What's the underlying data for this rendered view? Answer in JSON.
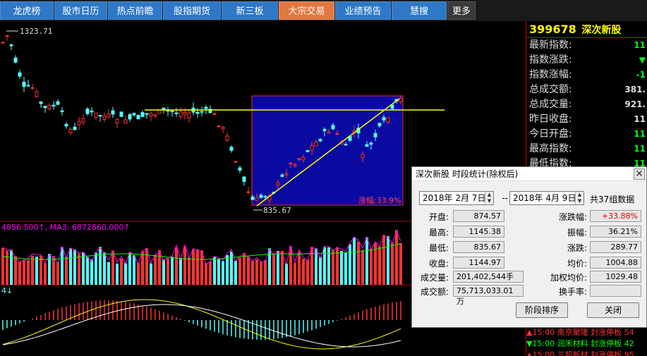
{
  "nav": {
    "items": [
      "龙虎榜",
      "股市日历",
      "热点前瞻",
      "股指期货",
      "新三板",
      "大宗交易",
      "业绩预告",
      "慧搜",
      "更多"
    ],
    "active_index": 5
  },
  "chart": {
    "high_label": "1323.71",
    "low_label": "835.67",
    "range_label": "涨幅:33.9%",
    "vol_text": "4856.500↑, MA3: 6872860.000↑",
    "macd_text": "4↓"
  },
  "panel": {
    "code": "399678",
    "name": "深次新股",
    "stats": [
      {
        "label": "最新指数:",
        "value": "11"
      },
      {
        "label": "指数涨跌:",
        "value": "▼"
      },
      {
        "label": "指数涨幅:",
        "value": "-1"
      },
      {
        "label": "总成交额:",
        "value": "381."
      },
      {
        "label": "总成交量:",
        "value": "921."
      },
      {
        "label": "昨日收盘:",
        "value": "11"
      },
      {
        "label": "今日开盘:",
        "value": "11"
      },
      {
        "label": "最高指数:",
        "value": "11"
      },
      {
        "label": "最低指数:",
        "value": "11"
      }
    ],
    "tickers": [
      {
        "time": "15:00",
        "text": "南京聚隆  封涨停板  54",
        "color": "#ff3333"
      },
      {
        "time": "15:00",
        "text": "润禾材料  封涨停板  42",
        "color": "#00ff00"
      },
      {
        "time": "15:00",
        "text": "三超新材  封涨停板  95",
        "color": "#ff3333"
      }
    ]
  },
  "dialog": {
    "title": "深次新股 时段统计(除权后)",
    "start_date": "2018年 2月 7日",
    "separator": "--",
    "end_date": "2018年 4月 9日",
    "count_text": "共37组数据",
    "left": [
      {
        "label": "开盘:",
        "value": "874.57"
      },
      {
        "label": "最高:",
        "value": "1145.38"
      },
      {
        "label": "最低:",
        "value": "835.67"
      },
      {
        "label": "收盘:",
        "value": "1144.97"
      },
      {
        "label": "成交量:",
        "value": "201,402,544手"
      },
      {
        "label": "成交额:",
        "value": "75,713,033.01万"
      }
    ],
    "right": [
      {
        "label": "涨跌幅:",
        "value": "+33.88%"
      },
      {
        "label": "振幅:",
        "value": "36.21%"
      },
      {
        "label": "涨跌:",
        "value": "289.77"
      },
      {
        "label": "均价:",
        "value": "1004.88"
      },
      {
        "label": "加权均价:",
        "value": "1029.48"
      },
      {
        "label": "换手率:",
        "value": ""
      }
    ],
    "btn_rank": "阶段排序",
    "btn_close": "关闭"
  },
  "colors": {
    "up": "#ff3333",
    "down": "#54ffff",
    "accent": "#ffff00",
    "nav": "#2e78c7",
    "nav_active": "#e2773f",
    "box": "#0a0aa0"
  }
}
